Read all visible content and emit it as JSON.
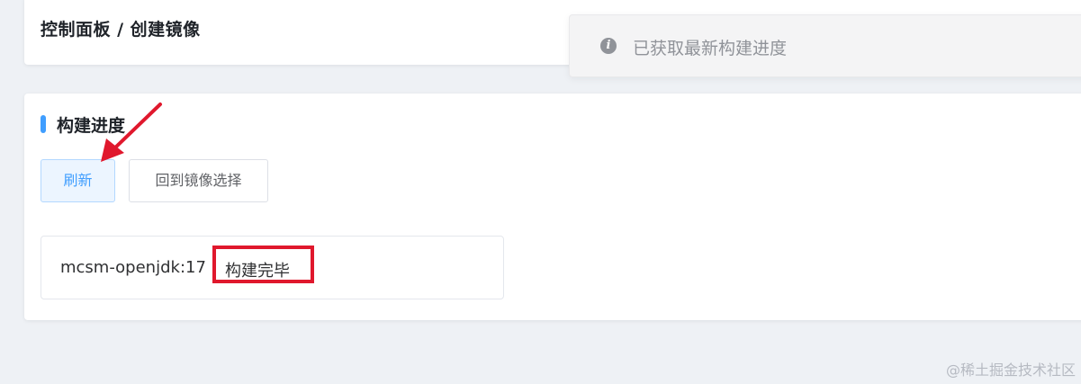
{
  "header": {
    "breadcrumb": "控制面板 / 创建镜像"
  },
  "notice": {
    "icon": "info-icon",
    "text": "已获取最新构建进度"
  },
  "section": {
    "title": "构建进度"
  },
  "actions": {
    "refresh_label": "刷新",
    "back_label": "回到镜像选择"
  },
  "build_item": {
    "image_name": "mcsm-openjdk:17",
    "status": "构建完毕"
  },
  "annotations": {
    "arrow_color": "#e0182d",
    "highlight_color": "#e0182d"
  },
  "watermark": "@稀土掘金技术社区",
  "colors": {
    "accent": "#409eff",
    "background": "#eef1f5"
  }
}
